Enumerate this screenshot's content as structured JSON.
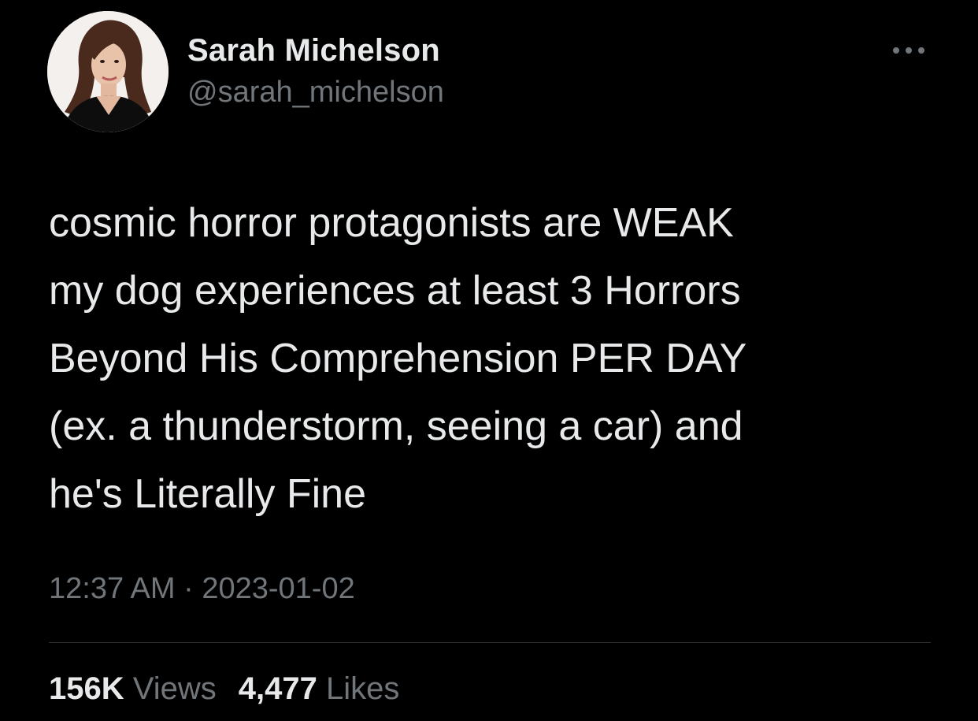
{
  "tweet": {
    "author": {
      "display_name": "Sarah Michelson",
      "handle": "@sarah_michelson",
      "avatar_icon": "profile-photo"
    },
    "more_icon": "ellipsis-icon",
    "text": "cosmic horror protagonists are WEAK\nmy dog experiences at least 3 Horrors\nBeyond His Comprehension PER DAY\n(ex. a thunderstorm, seeing a car) and\nhe's Literally Fine",
    "time": "12:37 AM",
    "separator": "·",
    "date": "2023-01-02",
    "stats": {
      "views_count": "156K",
      "views_label": "Views",
      "likes_count": "4,477",
      "likes_label": "Likes"
    }
  },
  "colors": {
    "background": "#000000",
    "primary_text": "#e7e9ea",
    "secondary_text": "#71767b",
    "divider": "#2f3336"
  }
}
